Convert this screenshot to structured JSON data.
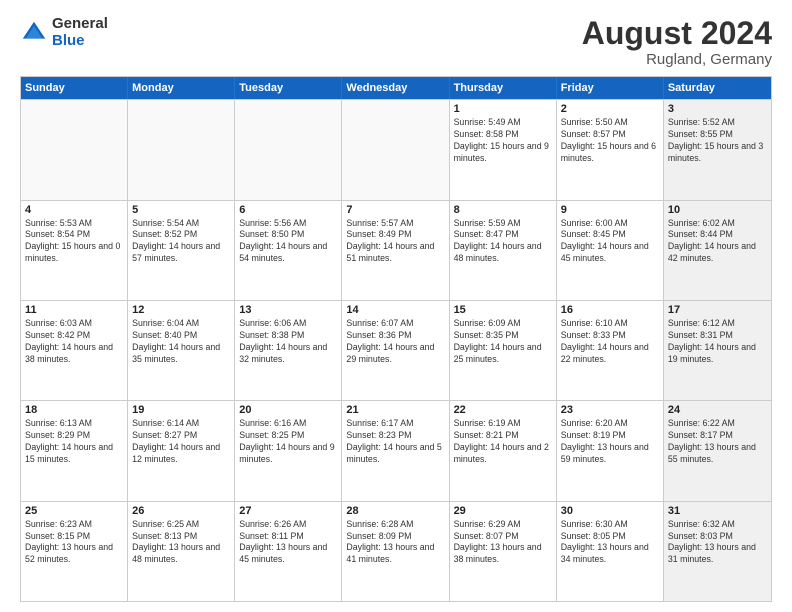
{
  "logo": {
    "general": "General",
    "blue": "Blue"
  },
  "header": {
    "month_year": "August 2024",
    "location": "Rugland, Germany"
  },
  "weekdays": [
    "Sunday",
    "Monday",
    "Tuesday",
    "Wednesday",
    "Thursday",
    "Friday",
    "Saturday"
  ],
  "rows": [
    [
      {
        "day": "",
        "empty": true
      },
      {
        "day": "",
        "empty": true
      },
      {
        "day": "",
        "empty": true
      },
      {
        "day": "",
        "empty": true
      },
      {
        "day": "1",
        "sunrise": "Sunrise: 5:49 AM",
        "sunset": "Sunset: 8:58 PM",
        "daylight": "Daylight: 15 hours and 9 minutes."
      },
      {
        "day": "2",
        "sunrise": "Sunrise: 5:50 AM",
        "sunset": "Sunset: 8:57 PM",
        "daylight": "Daylight: 15 hours and 6 minutes."
      },
      {
        "day": "3",
        "sunrise": "Sunrise: 5:52 AM",
        "sunset": "Sunset: 8:55 PM",
        "daylight": "Daylight: 15 hours and 3 minutes.",
        "shaded": true
      }
    ],
    [
      {
        "day": "4",
        "sunrise": "Sunrise: 5:53 AM",
        "sunset": "Sunset: 8:54 PM",
        "daylight": "Daylight: 15 hours and 0 minutes."
      },
      {
        "day": "5",
        "sunrise": "Sunrise: 5:54 AM",
        "sunset": "Sunset: 8:52 PM",
        "daylight": "Daylight: 14 hours and 57 minutes."
      },
      {
        "day": "6",
        "sunrise": "Sunrise: 5:56 AM",
        "sunset": "Sunset: 8:50 PM",
        "daylight": "Daylight: 14 hours and 54 minutes."
      },
      {
        "day": "7",
        "sunrise": "Sunrise: 5:57 AM",
        "sunset": "Sunset: 8:49 PM",
        "daylight": "Daylight: 14 hours and 51 minutes."
      },
      {
        "day": "8",
        "sunrise": "Sunrise: 5:59 AM",
        "sunset": "Sunset: 8:47 PM",
        "daylight": "Daylight: 14 hours and 48 minutes."
      },
      {
        "day": "9",
        "sunrise": "Sunrise: 6:00 AM",
        "sunset": "Sunset: 8:45 PM",
        "daylight": "Daylight: 14 hours and 45 minutes."
      },
      {
        "day": "10",
        "sunrise": "Sunrise: 6:02 AM",
        "sunset": "Sunset: 8:44 PM",
        "daylight": "Daylight: 14 hours and 42 minutes.",
        "shaded": true
      }
    ],
    [
      {
        "day": "11",
        "sunrise": "Sunrise: 6:03 AM",
        "sunset": "Sunset: 8:42 PM",
        "daylight": "Daylight: 14 hours and 38 minutes."
      },
      {
        "day": "12",
        "sunrise": "Sunrise: 6:04 AM",
        "sunset": "Sunset: 8:40 PM",
        "daylight": "Daylight: 14 hours and 35 minutes."
      },
      {
        "day": "13",
        "sunrise": "Sunrise: 6:06 AM",
        "sunset": "Sunset: 8:38 PM",
        "daylight": "Daylight: 14 hours and 32 minutes."
      },
      {
        "day": "14",
        "sunrise": "Sunrise: 6:07 AM",
        "sunset": "Sunset: 8:36 PM",
        "daylight": "Daylight: 14 hours and 29 minutes."
      },
      {
        "day": "15",
        "sunrise": "Sunrise: 6:09 AM",
        "sunset": "Sunset: 8:35 PM",
        "daylight": "Daylight: 14 hours and 25 minutes."
      },
      {
        "day": "16",
        "sunrise": "Sunrise: 6:10 AM",
        "sunset": "Sunset: 8:33 PM",
        "daylight": "Daylight: 14 hours and 22 minutes."
      },
      {
        "day": "17",
        "sunrise": "Sunrise: 6:12 AM",
        "sunset": "Sunset: 8:31 PM",
        "daylight": "Daylight: 14 hours and 19 minutes.",
        "shaded": true
      }
    ],
    [
      {
        "day": "18",
        "sunrise": "Sunrise: 6:13 AM",
        "sunset": "Sunset: 8:29 PM",
        "daylight": "Daylight: 14 hours and 15 minutes."
      },
      {
        "day": "19",
        "sunrise": "Sunrise: 6:14 AM",
        "sunset": "Sunset: 8:27 PM",
        "daylight": "Daylight: 14 hours and 12 minutes."
      },
      {
        "day": "20",
        "sunrise": "Sunrise: 6:16 AM",
        "sunset": "Sunset: 8:25 PM",
        "daylight": "Daylight: 14 hours and 9 minutes."
      },
      {
        "day": "21",
        "sunrise": "Sunrise: 6:17 AM",
        "sunset": "Sunset: 8:23 PM",
        "daylight": "Daylight: 14 hours and 5 minutes."
      },
      {
        "day": "22",
        "sunrise": "Sunrise: 6:19 AM",
        "sunset": "Sunset: 8:21 PM",
        "daylight": "Daylight: 14 hours and 2 minutes."
      },
      {
        "day": "23",
        "sunrise": "Sunrise: 6:20 AM",
        "sunset": "Sunset: 8:19 PM",
        "daylight": "Daylight: 13 hours and 59 minutes."
      },
      {
        "day": "24",
        "sunrise": "Sunrise: 6:22 AM",
        "sunset": "Sunset: 8:17 PM",
        "daylight": "Daylight: 13 hours and 55 minutes.",
        "shaded": true
      }
    ],
    [
      {
        "day": "25",
        "sunrise": "Sunrise: 6:23 AM",
        "sunset": "Sunset: 8:15 PM",
        "daylight": "Daylight: 13 hours and 52 minutes."
      },
      {
        "day": "26",
        "sunrise": "Sunrise: 6:25 AM",
        "sunset": "Sunset: 8:13 PM",
        "daylight": "Daylight: 13 hours and 48 minutes."
      },
      {
        "day": "27",
        "sunrise": "Sunrise: 6:26 AM",
        "sunset": "Sunset: 8:11 PM",
        "daylight": "Daylight: 13 hours and 45 minutes."
      },
      {
        "day": "28",
        "sunrise": "Sunrise: 6:28 AM",
        "sunset": "Sunset: 8:09 PM",
        "daylight": "Daylight: 13 hours and 41 minutes."
      },
      {
        "day": "29",
        "sunrise": "Sunrise: 6:29 AM",
        "sunset": "Sunset: 8:07 PM",
        "daylight": "Daylight: 13 hours and 38 minutes."
      },
      {
        "day": "30",
        "sunrise": "Sunrise: 6:30 AM",
        "sunset": "Sunset: 8:05 PM",
        "daylight": "Daylight: 13 hours and 34 minutes."
      },
      {
        "day": "31",
        "sunrise": "Sunrise: 6:32 AM",
        "sunset": "Sunset: 8:03 PM",
        "daylight": "Daylight: 13 hours and 31 minutes.",
        "shaded": true
      }
    ]
  ]
}
